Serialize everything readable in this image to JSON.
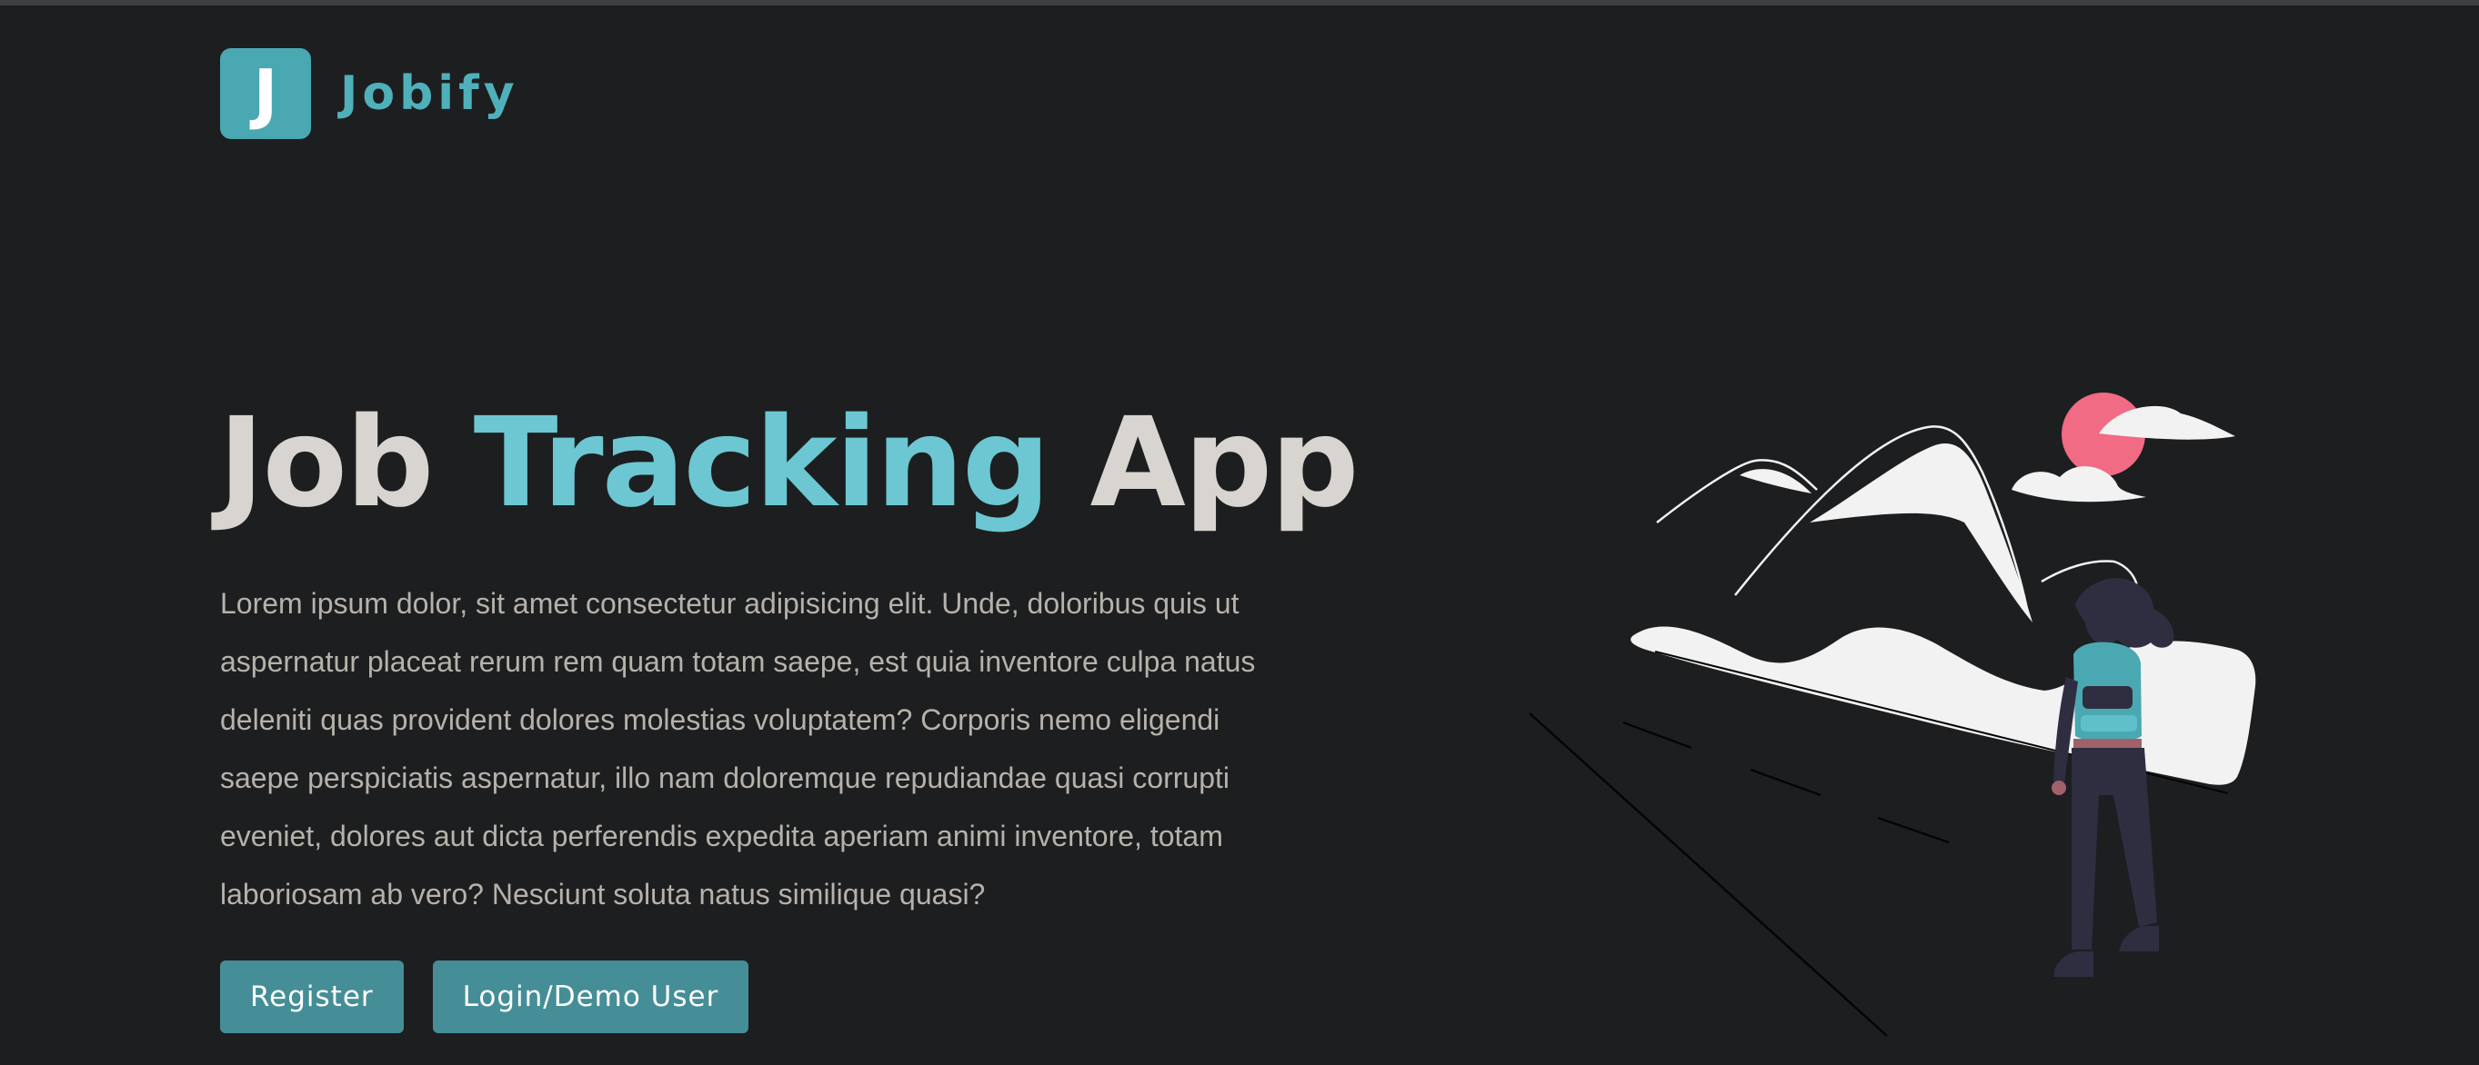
{
  "brand": {
    "logo_letter": "J",
    "name": "Jobify"
  },
  "hero": {
    "title_part1": "Job ",
    "title_accent": "Tracking",
    "title_part2": " App",
    "description": "Lorem ipsum dolor, sit amet consectetur adipisicing elit. Unde, doloribus quis ut aspernatur placeat rerum rem quam totam saepe, est quia inventore culpa natus deleniti quas provident dolores molestias voluptatem? Corporis nemo eligendi saepe perspiciatis aspernatur, illo nam doloremque repudiandae quasi corrupti eveniet, dolores aut dicta perferendis expedita aperiam animi inventore, totam laboriosam ab vero? Nesciunt soluta natus similique quasi?",
    "register_label": "Register",
    "login_label": "Login/Demo User"
  },
  "colors": {
    "background": "#1d1e20",
    "brand": "#4aa8b2",
    "accent": "#6cc7d2",
    "button": "#458e97",
    "sun": "#f06b83"
  },
  "illustration": {
    "icon": "hiker-mountains-illustration"
  }
}
